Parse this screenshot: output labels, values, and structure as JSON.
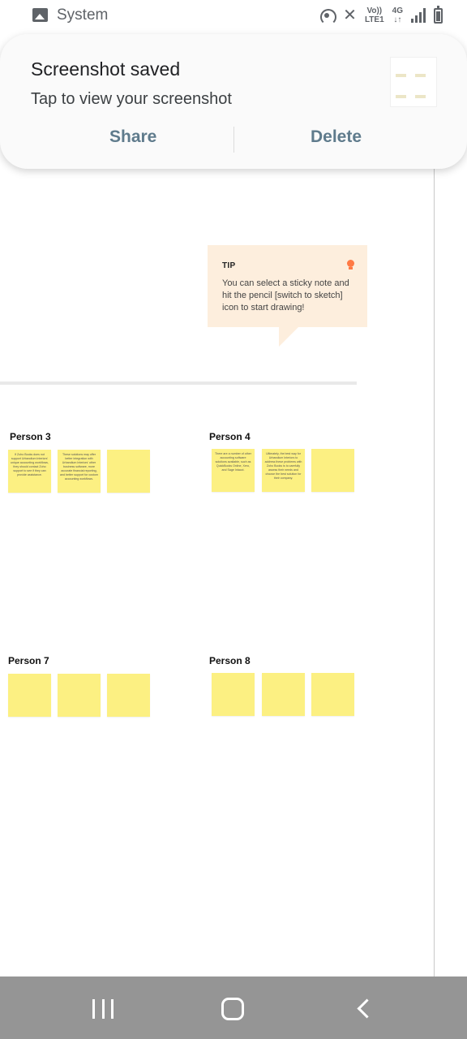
{
  "status_bar": {
    "app_name": "System",
    "volte_label": "Vo))",
    "lte_label": "LTE1",
    "network_label": "4G",
    "data_arrows": "↓↑",
    "icons": [
      "image-icon",
      "hotspot-icon",
      "mute-icon",
      "signal-icon",
      "battery-icon"
    ]
  },
  "notification": {
    "title": "Screenshot saved",
    "subtitle": "Tap to view your screenshot",
    "share_label": "Share",
    "delete_label": "Delete"
  },
  "tip": {
    "title": "TIP",
    "text": "You can select a sticky note and hit the pencil [switch to sketch] icon to start drawing!",
    "icon": "lightbulb-icon",
    "icon_color": "#ff7a45"
  },
  "persons": [
    {
      "label": "Person 3",
      "notes": [
        "If Zoho Books does not support Urbandium Interiors' unique accounting workflows, they should contact Zoho support to see if they can provide assistance.",
        "These solutions may offer better integration with Urbandium Interiors' other business software, more accurate financial reporting, and better support for custom accounting workflows.",
        ""
      ]
    },
    {
      "label": "Person 4",
      "notes": [
        "There are a number of other accounting software solutions available, such as QuickBooks Online, Xero, and Sage Intacct.",
        "Ultimately, the best way for Urbandium Interiors to address these problems with Zoho Books is to carefully assess their needs and choose the best solution for their company.",
        ""
      ]
    },
    {
      "label": "Person 7",
      "notes": [
        "",
        "",
        ""
      ]
    },
    {
      "label": "Person 8",
      "notes": [
        "",
        "",
        ""
      ]
    }
  ],
  "colors": {
    "sticky": "#fcf082",
    "tip_bg": "#fdeedd",
    "notif_action": "#5f7b8c",
    "nav_bar": "#959595"
  },
  "nav": {
    "icons": [
      "recent-apps-icon",
      "home-icon",
      "back-icon"
    ]
  }
}
